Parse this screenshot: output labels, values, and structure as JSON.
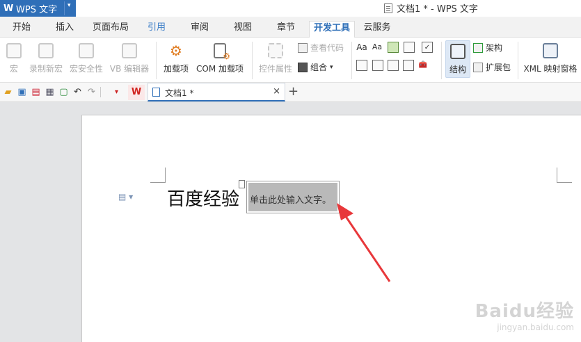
{
  "app": {
    "logo": "W",
    "name": "WPS 文字",
    "menu_arrow": "▾"
  },
  "window": {
    "title": "文档1 * - WPS 文字"
  },
  "tabs": [
    {
      "label": "开始"
    },
    {
      "label": "插入"
    },
    {
      "label": "页面布局"
    },
    {
      "label": "引用"
    },
    {
      "label": "审阅"
    },
    {
      "label": "视图"
    },
    {
      "label": "章节"
    },
    {
      "label": "开发工具"
    },
    {
      "label": "云服务"
    }
  ],
  "ribbon": {
    "macro": "宏",
    "record_macro": "录制新宏",
    "macro_security": "宏安全性",
    "vb_editor": "VB 编辑器",
    "addins": "加载项",
    "com_addins": "COM 加载项",
    "control_properties": "控件属性",
    "view_code": "查看代码",
    "group": "组合",
    "structure": "结构",
    "schema": "架构",
    "expansion_pack": "扩展包",
    "xml_mapping": "XML 映射窗格",
    "aa_rich": "Aa",
    "aa_plain": "Aa"
  },
  "doc_tab": {
    "label": "文档1 *",
    "close": "×",
    "add": "+"
  },
  "document": {
    "heading": "百度经验",
    "placeholder": "单击此处输入文字。"
  },
  "watermark": {
    "line1": "Baidu经验",
    "line2": "jingyan.baidu.com"
  },
  "colors": {
    "accent": "#2f6fb8",
    "arrow": "#e8383b",
    "placeholder_bg": "#b9b9b9"
  }
}
